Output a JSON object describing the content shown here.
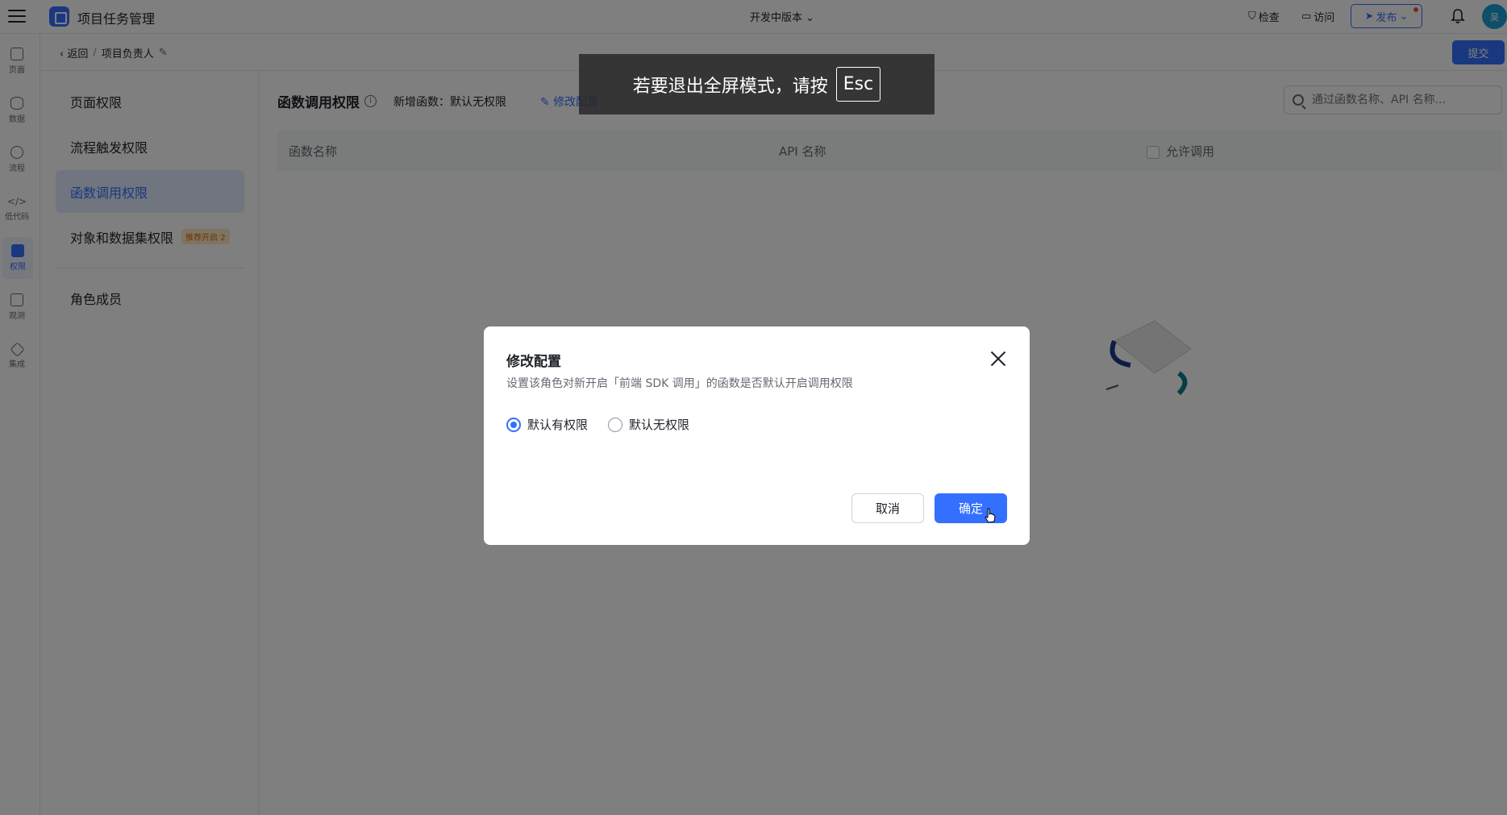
{
  "topbar": {
    "app_title": "项目任务管理",
    "version": "开发中版本",
    "inspect": "检查",
    "visit": "访问",
    "publish": "发布",
    "avatar": "吴"
  },
  "rail": {
    "items": [
      {
        "label": "页面",
        "icon": "page-icon"
      },
      {
        "label": "数据",
        "icon": "database-icon"
      },
      {
        "label": "流程",
        "icon": "flow-icon"
      },
      {
        "label": "低代码",
        "icon": "code-icon"
      },
      {
        "label": "权限",
        "icon": "lock-icon"
      },
      {
        "label": "观测",
        "icon": "monitor-icon"
      },
      {
        "label": "集成",
        "icon": "integration-icon"
      }
    ]
  },
  "subheader": {
    "back": "返回",
    "role_name": "项目负责人",
    "submit": "提交"
  },
  "menu": {
    "items": [
      {
        "label": "页面权限"
      },
      {
        "label": "流程触发权限"
      },
      {
        "label": "函数调用权限"
      },
      {
        "label": "对象和数据集权限",
        "badge": "推荐开启 2"
      },
      {
        "label": "角色成员"
      }
    ]
  },
  "main": {
    "title": "函数调用权限",
    "new_func": "新增函数：默认无权限",
    "edit_link": "修改配置",
    "search_placeholder": "通过函数名称、API 名称...",
    "columns": [
      "函数名称",
      "API 名称",
      "允许调用"
    ]
  },
  "toast": {
    "text": "若要退出全屏模式，请按",
    "key": "Esc"
  },
  "dialog": {
    "title": "修改配置",
    "description": "设置该角色对新开启「前端 SDK 调用」的函数是否默认开启调用权限",
    "options": [
      "默认有权限",
      "默认无权限"
    ],
    "selected": "默认有权限",
    "cancel": "取消",
    "confirm": "确定"
  },
  "colors": {
    "primary": "#3370ff",
    "badge_bg": "#ffe8c2",
    "overlay": "rgba(0,0,0,0.5)"
  }
}
